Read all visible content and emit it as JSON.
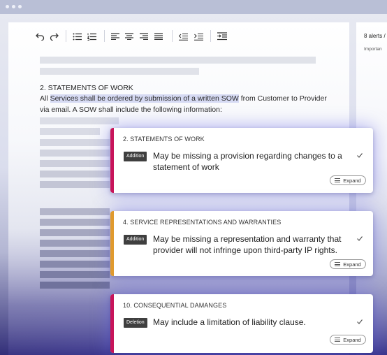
{
  "colors": {
    "accent_pink": "#c8145a",
    "accent_orange": "#e09a2e",
    "highlight": "#d6daf3"
  },
  "toolbar": {
    "icons": [
      "undo-icon",
      "redo-icon",
      "bullet-list-icon",
      "numbered-list-icon",
      "align-left-icon",
      "align-center-icon",
      "align-right-icon",
      "align-justify-icon",
      "outdent-icon",
      "indent-icon",
      "insert-icon"
    ]
  },
  "side_panel": {
    "alerts": "8 alerts /",
    "filter": "Importan"
  },
  "document": {
    "heading": "2. STATEMENTS OF WORK",
    "line1_prefix": "All ",
    "line1_highlight": "Services shall be ordered by submission of a written SOW",
    "line1_suffix": " from Customer to Provider",
    "line2": "via email. A SOW shall include the following information:"
  },
  "alerts": [
    {
      "title": "2. STATEMENTS OF WORK",
      "tag": "Addition",
      "message": "May be missing a provision regarding changes to a statement of work",
      "expand_label": "Expand"
    },
    {
      "title": "4. SERVICE REPRESENTATIONS AND WARRANTIES",
      "tag": "Addition",
      "message": "May be missing a representation and warranty that provider will not infringe upon third-party IP rights.",
      "expand_label": "Expand"
    },
    {
      "title": "10. CONSEQUENTIAL DAMANGES",
      "tag": "Deletion",
      "message": "May include a limitation of liability clause.",
      "expand_label": "Expand"
    }
  ]
}
